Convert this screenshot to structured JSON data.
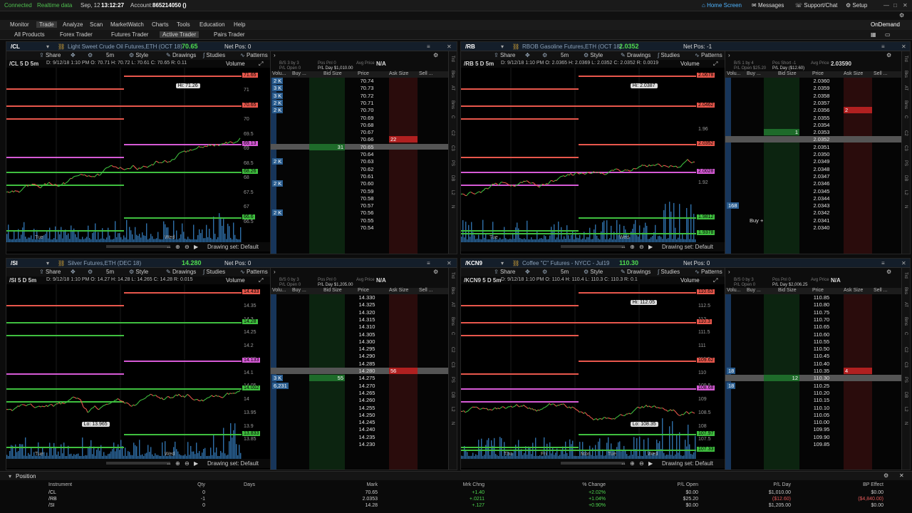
{
  "topbar": {
    "status": "Connected",
    "feed": "Realtime data",
    "date": "Sep, 12",
    "time": "13:12:27",
    "account_label": "Account:",
    "account": "865214050 ()",
    "home": "Home Screen",
    "messages": "Messages",
    "support": "Support/Chat",
    "setup": "Setup"
  },
  "menu": [
    "Monitor",
    "Trade",
    "Analyze",
    "Scan",
    "MarketWatch",
    "Charts",
    "Tools",
    "Education",
    "Help"
  ],
  "ondemand": "OnDemand",
  "submenu": [
    "All Products",
    "Forex Trader",
    "Futures Trader",
    "Active Trader",
    "Pairs Trader"
  ],
  "toolbar": {
    "share": "Share",
    "interval": "5m",
    "style": "Style",
    "drawings": "Drawings",
    "studies": "Studies",
    "patterns": "Patterns",
    "drawing_set": "Drawing set: Default",
    "volume": "Volume"
  },
  "ladder_cols": [
    "Volu...",
    "Buy ...",
    "Bid Size",
    "Price",
    "Ask Size",
    "Sell ..."
  ],
  "panels": [
    {
      "symbol": "/CL",
      "desc": "Light Sweet Crude Oil Futures,ETH (OCT 18)",
      "last": "70.65",
      "netpos": "Net Pos: 0",
      "info": "/CL 5 D 5m",
      "ohlc": "D: 9/12/18 1:10 PM  O: 70.71  H: 70.72  L: 70.61  C: 70.65  R: 0.11",
      "hi": "Hi: 71.26",
      "lo": "",
      "dates": [
        "Tue",
        "Wed"
      ],
      "price_labels": [
        {
          "v": "71.65",
          "c": "#e8574c"
        },
        {
          "v": "70.65",
          "c": "#e8574c"
        },
        {
          "v": "69.13",
          "c": "#d65ad6"
        },
        {
          "v": "68.26",
          "c": "#3fbf3f"
        },
        {
          "v": "66.6",
          "c": "#3fbf3f"
        }
      ],
      "axis": [
        "71.5",
        "71",
        "70.5",
        "70",
        "69.5",
        "69",
        "68.5",
        "68",
        "67.5",
        "67",
        "66.5"
      ],
      "lhead": {
        "a": "B/S 3 by 3",
        "b": "Pos Pnl 0",
        "avg": "Avg Price",
        "na": "N/A",
        "open": "P/L Open 0",
        "day": "P/L Day $1,010.00"
      },
      "ladder": [
        {
          "p": "70.74",
          "vol": "2 K"
        },
        {
          "p": "70.73",
          "vol": "3 K"
        },
        {
          "p": "70.72",
          "vol": "3 K"
        },
        {
          "p": "70.71",
          "vol": "2 K"
        },
        {
          "p": "70.70",
          "vol": "2 K"
        },
        {
          "p": "70.69"
        },
        {
          "p": "70.68"
        },
        {
          "p": "70.67"
        },
        {
          "p": "70.66",
          "ask": "22"
        },
        {
          "p": "70.65",
          "bid": "31",
          "hl": true
        },
        {
          "p": "70.64"
        },
        {
          "p": "70.63",
          "vol": "2 K"
        },
        {
          "p": "70.62"
        },
        {
          "p": "70.61"
        },
        {
          "p": "70.60",
          "vol": "2 K"
        },
        {
          "p": "70.59"
        },
        {
          "p": "70.58"
        },
        {
          "p": "70.57"
        },
        {
          "p": "70.56",
          "vol": "2 K"
        },
        {
          "p": "70.55"
        },
        {
          "p": "70.54"
        }
      ]
    },
    {
      "symbol": "/RB",
      "desc": "RBOB Gasoline Futures,ETH (OCT 18)",
      "last": "2.0352",
      "netpos": "Net Pos: -1",
      "info": "/RB 5 D 5m",
      "ohlc": "D: 9/12/18 1:10 PM  O: 2.0365  H: 2.0369  L: 2.0352  C: 2.0352  R: 0.0019",
      "hi": "Hi: 2.0387",
      "lo": "",
      "dates": [
        "Tue",
        "Wed"
      ],
      "price_labels": [
        {
          "v": "2.0678",
          "c": "#e8574c"
        },
        {
          "v": "2.0462",
          "c": "#e8574c"
        },
        {
          "v": "2.0352",
          "c": "#e8574c"
        },
        {
          "v": "2.0028",
          "c": "#d65ad6"
        },
        {
          "v": "1.9812",
          "c": "#3fbf3f"
        },
        {
          "v": "1.9378",
          "c": "#3fbf3f"
        }
      ],
      "axis": [
        "2.02",
        "1.96",
        "1.92"
      ],
      "lhead": {
        "a": "B/S 1 by 4",
        "b": "Pos Short -1",
        "avg": "Avg Price",
        "na": "2.03590",
        "open": "P/L Open $25.20",
        "day": "P/L Day ($12.60)"
      },
      "ladder": [
        {
          "p": "2.0360"
        },
        {
          "p": "2.0359"
        },
        {
          "p": "2.0358"
        },
        {
          "p": "2.0357"
        },
        {
          "p": "2.0356",
          "ask": "2"
        },
        {
          "p": "2.0355"
        },
        {
          "p": "2.0354"
        },
        {
          "p": "2.0353",
          "bid": "1"
        },
        {
          "p": "2.0352",
          "hl": true
        },
        {
          "p": "2.0351"
        },
        {
          "p": "2.0350"
        },
        {
          "p": "2.0349"
        },
        {
          "p": "2.0348"
        },
        {
          "p": "2.0347"
        },
        {
          "p": "2.0346"
        },
        {
          "p": "2.0345"
        },
        {
          "p": "2.0344"
        },
        {
          "p": "2.0343",
          "vol": "168"
        },
        {
          "p": "2.0342"
        },
        {
          "p": "2.0341",
          "buy": "Buy +"
        },
        {
          "p": "2.0340"
        }
      ]
    },
    {
      "symbol": "/SI",
      "desc": "Silver Futures,ETH (DEC 18)",
      "last": "14.280",
      "netpos": "Net Pos: 0",
      "info": "/SI 5 D 5m",
      "ohlc": "D: 9/12/18 1:10 PM  O: 14.27  H: 14.28  L: 14.265  C: 14.28  R: 0.015",
      "hi": "",
      "lo": "Lo: 13.965",
      "dates": [
        "Tue",
        "Wed"
      ],
      "price_labels": [
        {
          "v": "14.433",
          "c": "#e8574c"
        },
        {
          "v": "14.28",
          "c": "#3fbf3f"
        },
        {
          "v": "14.133",
          "c": "#d65ad6"
        },
        {
          "v": "14.002",
          "c": "#3fbf3f"
        },
        {
          "v": "13.833",
          "c": "#3fbf3f"
        }
      ],
      "axis": [
        "14.4",
        "14.35",
        "14.3",
        "14.25",
        "14.2",
        "14.15",
        "14.1",
        "14.05",
        "14",
        "13.95",
        "13.9",
        "13.85"
      ],
      "lhead": {
        "a": "B/S 0 by 3",
        "b": "Pos Pnl 0",
        "avg": "Avg Price",
        "na": "N/A",
        "open": "P/L Open 0",
        "day": "P/L Day $1,205.00"
      },
      "ladder": [
        {
          "p": "14.330"
        },
        {
          "p": "14.325"
        },
        {
          "p": "14.320"
        },
        {
          "p": "14.315"
        },
        {
          "p": "14.310"
        },
        {
          "p": "14.305"
        },
        {
          "p": "14.300"
        },
        {
          "p": "14.295"
        },
        {
          "p": "14.290"
        },
        {
          "p": "14.285"
        },
        {
          "p": "14.280",
          "ask": "56",
          "hl": true
        },
        {
          "p": "14.275",
          "bid": "55",
          "vol": "3 K"
        },
        {
          "p": "14.270",
          "vol": "6,231"
        },
        {
          "p": "14.265"
        },
        {
          "p": "14.260"
        },
        {
          "p": "14.255"
        },
        {
          "p": "14.250"
        },
        {
          "p": "14.245"
        },
        {
          "p": "14.240"
        },
        {
          "p": "14.235"
        },
        {
          "p": "14.230"
        }
      ]
    },
    {
      "symbol": "/KCN9",
      "desc": "Coffee \"C\" Futures - NYCC - Jul19",
      "last": "110.30",
      "netpos": "Net Pos: 0",
      "info": "/KCN9 5 D 5m",
      "ohlc": "D: 9/12/18 1:10 PM  O: 110.4  H: 110.4  L: 110.3  C: 110.3  R: 0.1",
      "hi": "Hi: 112.05",
      "lo": "Lo: 108.35",
      "dates": [
        "Thu",
        "Fri",
        "Mon",
        "Tue",
        "Wed"
      ],
      "price_labels": [
        {
          "v": "110.63",
          "c": "#e8574c"
        },
        {
          "v": "110.3",
          "c": "#e8574c"
        },
        {
          "v": "109.62",
          "c": "#e8574c"
        },
        {
          "v": "108.68",
          "c": "#d65ad6"
        },
        {
          "v": "107.97",
          "c": "#3fbf3f"
        },
        {
          "v": "107.33",
          "c": "#3fbf3f"
        }
      ],
      "axis": [
        "113",
        "112.5",
        "112",
        "111.5",
        "111",
        "110.5",
        "110",
        "109.5",
        "109",
        "108.5",
        "108",
        "107.5"
      ],
      "lhead": {
        "a": "B/S 0 by 3",
        "b": "Pos Pnl 0",
        "avg": "Avg Price",
        "na": "N/A",
        "open": "P/L Open 0",
        "day": "P/L Day $2,006.25"
      },
      "ladder": [
        {
          "p": "110.85"
        },
        {
          "p": "110.80"
        },
        {
          "p": "110.75"
        },
        {
          "p": "110.70"
        },
        {
          "p": "110.65"
        },
        {
          "p": "110.60"
        },
        {
          "p": "110.55"
        },
        {
          "p": "110.50"
        },
        {
          "p": "110.45"
        },
        {
          "p": "110.40"
        },
        {
          "p": "110.35",
          "ask": "4",
          "vol": "18"
        },
        {
          "p": "110.30",
          "bid": "12",
          "hl": true
        },
        {
          "p": "110.25",
          "vol": "18"
        },
        {
          "p": "110.20"
        },
        {
          "p": "110.15"
        },
        {
          "p": "110.10"
        },
        {
          "p": "110.05"
        },
        {
          "p": "110.00"
        },
        {
          "p": "109.95"
        },
        {
          "p": "109.90"
        },
        {
          "p": "109.85"
        }
      ]
    }
  ],
  "position": {
    "title": "Position",
    "headers": [
      "Instrument",
      "Qty",
      "Days",
      "Mark",
      "Mrk Chng",
      "% Change",
      "P/L Open",
      "P/L Day",
      "BP Effect"
    ],
    "rows": [
      [
        "/CL",
        "0",
        "",
        "70.65",
        "+1.40",
        "+2.02%",
        "$0.00",
        "$1,010.00",
        "$0.00"
      ],
      [
        "/RB",
        "-1",
        "",
        "2.0353",
        "+.0211",
        "+1.04%",
        "$25.20",
        "($12.60)",
        "($4,840.00)"
      ],
      [
        "/SI",
        "0",
        "",
        "14.28",
        "+.127",
        "+0.90%",
        "$0.00",
        "$1,205.00",
        "$0.00"
      ]
    ]
  },
  "sidebar": [
    "Trd",
    "Bks",
    "AT",
    "Bms",
    "C",
    "C2",
    "C3",
    "PS",
    "DB",
    "L2",
    "N"
  ],
  "colors": {
    "up": "#3fbf3f",
    "down": "#e8574c",
    "pivot": "#d65ad6",
    "volume": "#2f6fa8",
    "accent": "#29a329"
  }
}
